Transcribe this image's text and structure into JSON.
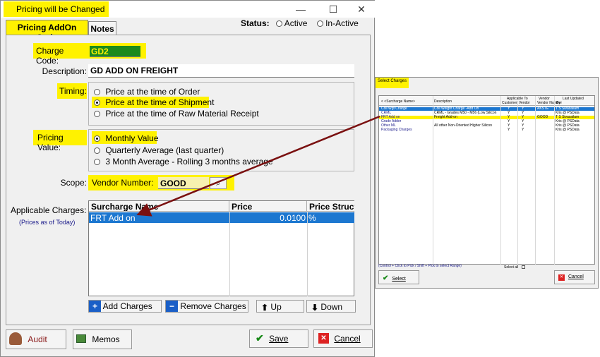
{
  "window": {
    "title": "Pricing will be Changed",
    "minimize": "—",
    "maximize": "☐",
    "close": "✕"
  },
  "tabs": [
    "Pricing AddOn Code",
    "Notes"
  ],
  "status": {
    "label": "Status:",
    "options": [
      "Active",
      "In-Active"
    ]
  },
  "form": {
    "charge_code_label": "Charge Code:",
    "charge_code": "GD2",
    "description_label": "Description:",
    "description": "GD ADD ON FREIGHT",
    "timing_label": "Timing:",
    "timing_options": [
      "Price at the time of Order",
      "Price at the time of Shipment",
      "Price at the time of Raw Material Receipt"
    ],
    "timing_selected": 1,
    "pricing_value_label": "Pricing Value:",
    "pricing_value_options": [
      "Monthly Value",
      "Quarterly Average (last quarter)",
      "3 Month Average - Rolling 3 months average"
    ],
    "pricing_value_selected": 0,
    "scope_label": "Scope:",
    "scope_value_label": "Vendor Number:",
    "scope_value": "GOOD",
    "applicable_label": "Applicable Charges:",
    "applicable_sub": "(Prices as of Today)"
  },
  "charges_grid": {
    "columns": [
      "Surcharge Name",
      "Price",
      "Price Structu"
    ],
    "rows": [
      {
        "name": "FRT Add on",
        "price": "0.0100",
        "structure": "%"
      }
    ]
  },
  "grid_buttons": {
    "add": "Add Charges",
    "remove": "Remove Charges",
    "up": "Up",
    "down": "Down"
  },
  "footer": {
    "audit": "Audit",
    "memos": "Memos",
    "save": "Save",
    "cancel": "Cancel"
  },
  "select_charges": {
    "title": "Select Charges",
    "headers": {
      "name": "< <Surcharge Name>",
      "description": "Description",
      "applicable_to": "Applicable To",
      "customer": "Customer",
      "vendor": "Vendor",
      "vendor_number": "Vendor Number",
      "last_updated": "Last Updated",
      "by": "By"
    },
    "rows": [
      {
        "name": "Coil Wgt Charge",
        "description": "Coil Weight Charge -Add On",
        "customer": "Y",
        "vendor": "Y",
        "vendor_number": "AKSTE",
        "by": "T S Sivasailam"
      },
      {
        "name": "CRML",
        "description": "CRML - Grades M50 - M56 (Low Silicon",
        "customer": "Y",
        "vendor": "Y",
        "vendor_number": "",
        "by": "Kris @ PSData"
      },
      {
        "name": "FRT Add on",
        "description": "Freight Add-on",
        "customer": "Y",
        "vendor": "Y",
        "vendor_number": "GOOD",
        "by": "T S Sivasailam"
      },
      {
        "name": "Grade Adder",
        "description": "",
        "customer": "Y",
        "vendor": "Y",
        "vendor_number": "",
        "by": "Kris @ PSData"
      },
      {
        "name": "Other ML",
        "description": "All other Non-Oriented Higher Silicon",
        "customer": "Y",
        "vendor": "Y",
        "vendor_number": "",
        "by": "Kris @ PSData"
      },
      {
        "name": "Packaging Charges",
        "description": "",
        "customer": "Y",
        "vendor": "Y",
        "vendor_number": "",
        "by": "Kris @ PSData"
      }
    ],
    "hint": "(Control + Click to Pick / Shift + Pick to select Range)",
    "select_all": "Select all",
    "select_button": "Select",
    "cancel_button": "Cancel"
  }
}
